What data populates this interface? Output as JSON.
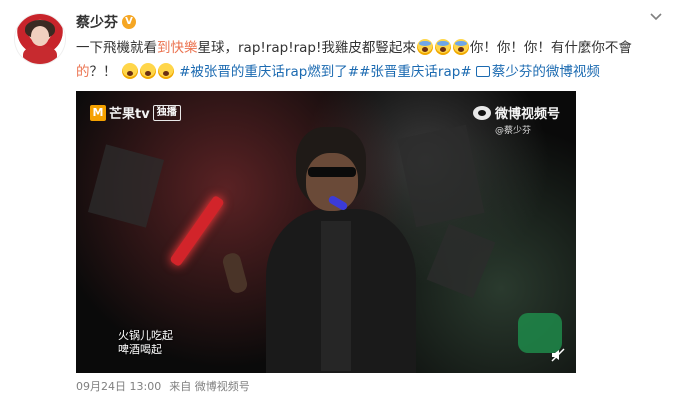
{
  "post": {
    "username": "蔡少芬",
    "verified_badge": "V",
    "text_part1": "一下飛機就看",
    "text_link_show": "到快樂",
    "text_part2": "星球，rap!rap!rap!我雞皮都豎起來",
    "text_part3": "你！你！你！有什麼你不會",
    "text_red_de": "的",
    "text_part4": "？！",
    "hashtag1": "#被张晋的重庆话rap燃到了#",
    "hashtag2": "#张晋重庆话rap#",
    "video_link": "蔡少芬的微博视频",
    "timestamp": "09月24日 13:00",
    "source": "来自 微博视频号",
    "icons": {
      "chevron": "chevron-down-icon",
      "emoji_scream": "scream-emoji-icon",
      "emoji_laugh": "laugh-emoji-icon",
      "video": "video-icon",
      "mute": "mute-icon"
    }
  },
  "video": {
    "channel_logo_text": "芒果tv",
    "exclusive_tag": "独播",
    "watermark_title": "微博视频号",
    "watermark_handle": "@蔡少芬",
    "subtitle_line1": "火锅儿吃起",
    "subtitle_line2": "啤酒喝起"
  },
  "colors": {
    "accent_link": "#eb7350",
    "hashtag_blue": "#1b6ab1",
    "badge_orange": "#f5a623"
  }
}
